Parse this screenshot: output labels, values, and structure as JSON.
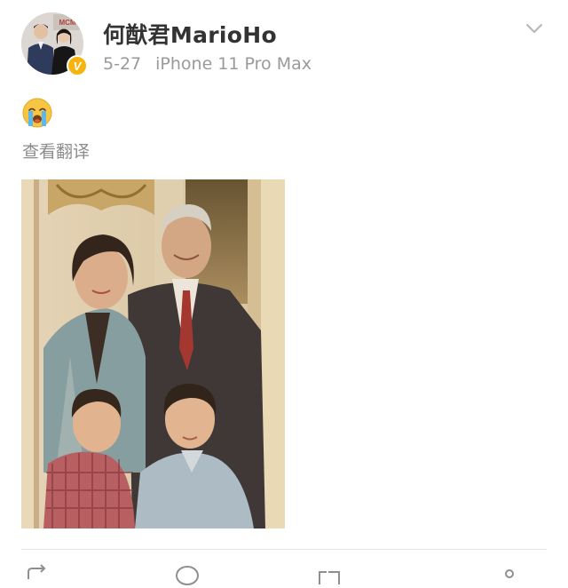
{
  "header": {
    "username": "何猷君MarioHo",
    "date": "5-27",
    "device": "iPhone 11 Pro Max",
    "verified_badge": "V",
    "verified_color": "#f6b40e"
  },
  "post": {
    "emoji": "crying-face-emoji",
    "translate_label": "查看翻译",
    "photo": "family-portrait-photo"
  },
  "actions": {
    "repost_label": "",
    "comment_label": "",
    "like_label": ""
  },
  "colors": {
    "username": "#333333",
    "meta": "#9a9a9a",
    "divider": "#e6e6e6"
  }
}
